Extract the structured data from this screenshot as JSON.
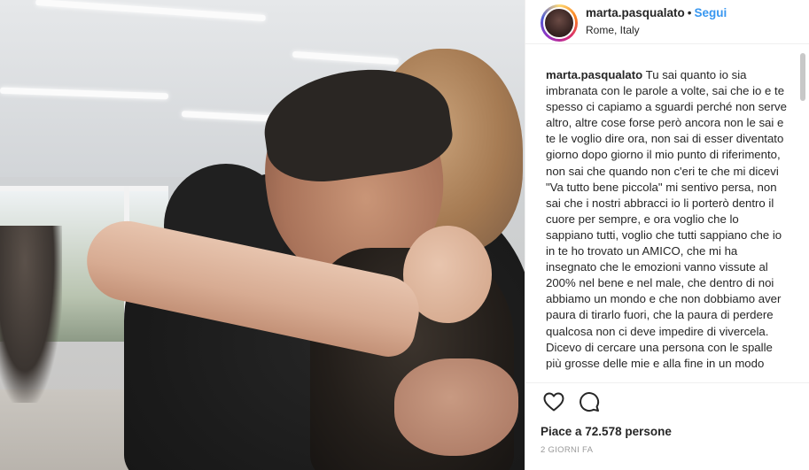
{
  "header": {
    "username": "marta.pasqualato",
    "separator": "•",
    "follow_label": "Segui",
    "location": "Rome, Italy"
  },
  "post": {
    "photo_icon": "photo-image",
    "caption_username": "marta.pasqualato",
    "caption_text": "Tu sai quanto io sia imbranata con le parole a volte, sai che io e te spesso ci capiamo a sguardi perché non serve altro, altre cose forse però ancora non le sai e te le voglio dire ora, non sai di esser diventato giorno dopo giorno il mio punto di riferimento, non sai che quando non c'eri te che mi dicevi \"Va tutto bene piccola\" mi sentivo persa, non sai che i nostri abbracci io li porterò dentro il cuore per sempre, e ora voglio che lo sappiano tutti, voglio che tutti sappiano che io in te ho trovato un AMICO, che mi ha insegnato che le emozioni vanno vissute al 200% nel bene e nel male, che dentro di noi abbiamo un mondo e che non dobbiamo aver paura di tirarlo fuori, che la paura di perdere qualcosa non ci deve impedire di vivercela. Dicevo di cercare una persona con le spalle più grosse delle mie e alla fine in un modo"
  },
  "actions": {
    "like_icon": "heart-icon",
    "comment_icon": "comment-icon",
    "likes_text": "Piace a 72.578 persone",
    "timestamp": "2 GIORNI FA"
  },
  "colors": {
    "follow": "#3897f0",
    "text": "#262626",
    "muted": "#999999",
    "border": "#efefef"
  }
}
